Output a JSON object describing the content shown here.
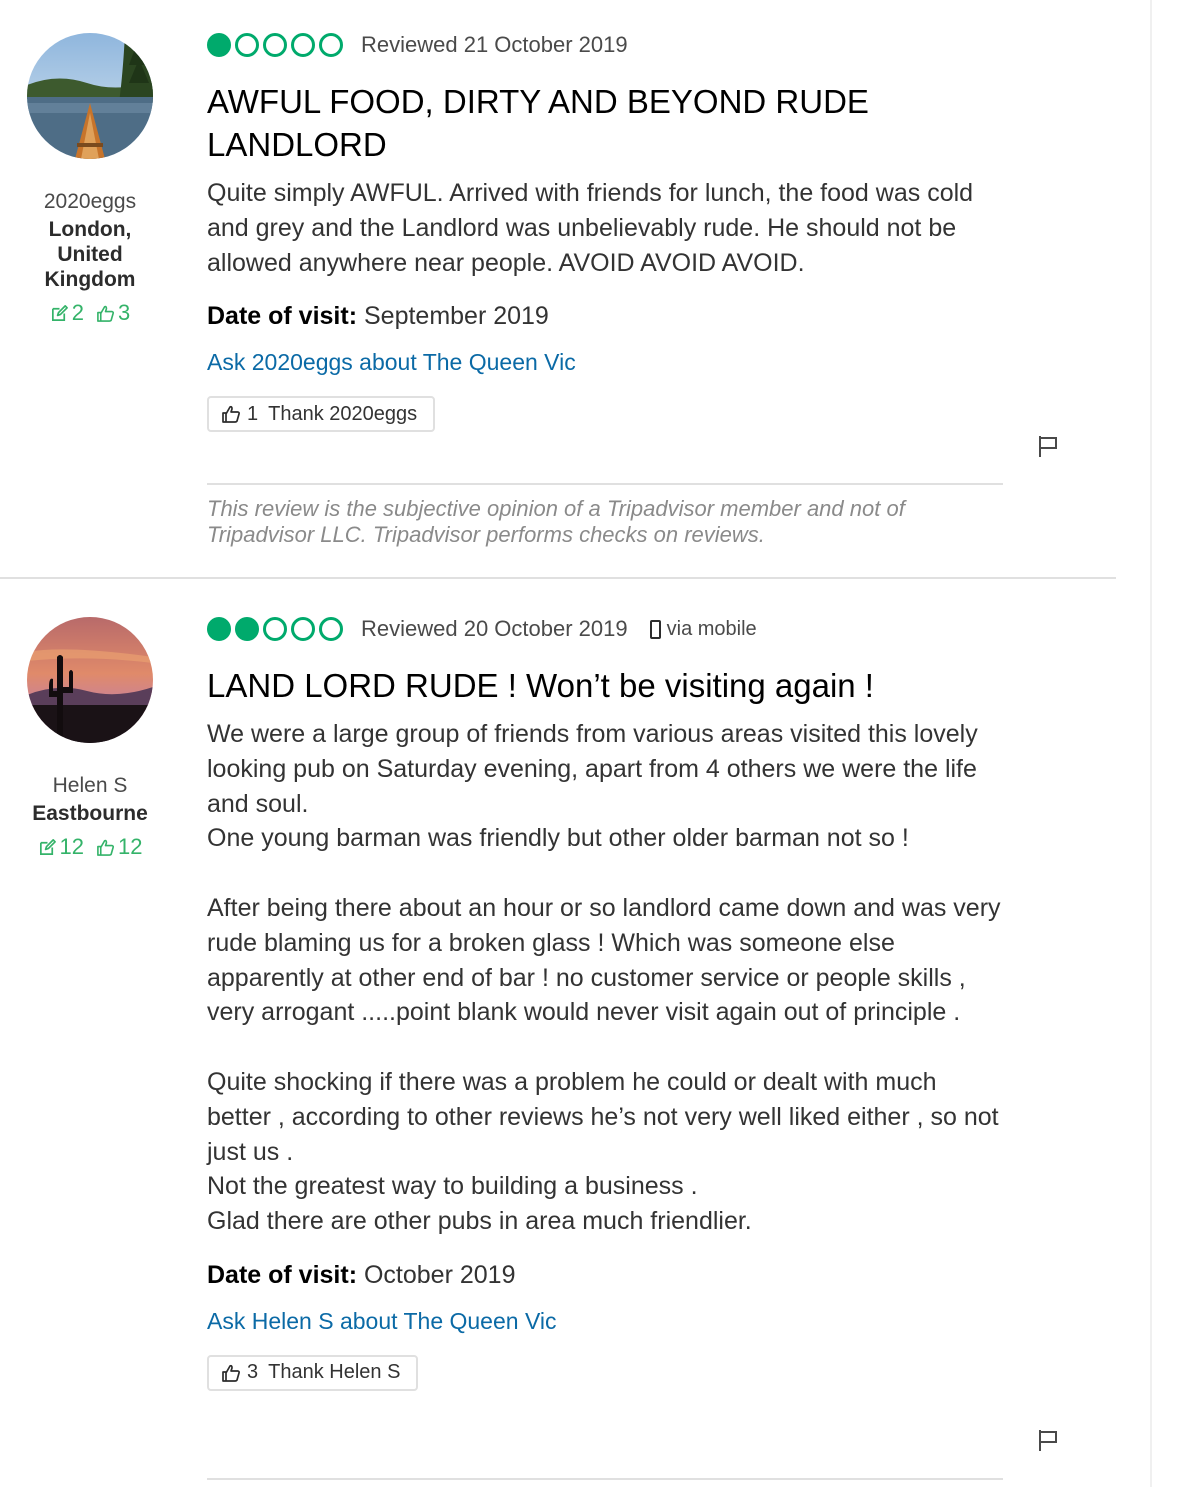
{
  "reviews": [
    {
      "member": {
        "name": "2020eggs",
        "location": "London, United Kingdom",
        "contributions": "2",
        "helpful_votes": "3"
      },
      "rating": 1,
      "reviewed_date": "Reviewed 21 October 2019",
      "via": "",
      "title": "AWFUL FOOD, DIRTY AND BEYOND RUDE LANDLORD",
      "body": "Quite simply AWFUL. Arrived with friends for lunch, the food was cold and grey and the Landlord was unbelievably rude. He should not be allowed anywhere near people. AVOID AVOID AVOID.",
      "date_of_visit_label": "Date of visit:",
      "date_of_visit": "September 2019",
      "ask_link": "Ask 2020eggs about The Queen Vic",
      "thank_count": "1",
      "thank_label": "Thank 2020eggs",
      "disclaimer": "This review is the subjective opinion of a Tripadvisor member and not of Tripadvisor LLC. Tripadvisor performs checks on reviews."
    },
    {
      "member": {
        "name": "Helen S",
        "location": "Eastbourne",
        "contributions": "12",
        "helpful_votes": "12"
      },
      "rating": 2,
      "reviewed_date": "Reviewed 20 October 2019",
      "via": "via mobile",
      "title": "LAND LORD RUDE ! Won’t be visiting again !",
      "body": "We were a large group of friends from various areas visited this lovely looking pub on Saturday evening, apart from 4 others we were the life and soul.\nOne young barman was friendly but other older barman not so !\n\nAfter being there about an hour or so landlord came down and was very rude blaming us for a broken glass ! Which was someone else apparently at other end of bar ! no customer service or people skills , very arrogant .....point blank would never visit again out of principle .\n\nQuite shocking if there was a problem he could or dealt with much better , according to other reviews he’s not very well liked either , so not just us .\nNot the greatest way to building a business .\nGlad there are other pubs in area much friendlier.",
      "date_of_visit_label": "Date of visit:",
      "date_of_visit": "October 2019",
      "ask_link": "Ask Helen S about The Queen Vic",
      "thank_count": "3",
      "thank_label": "Thank Helen S"
    }
  ],
  "colors": {
    "bubble_green": "#00aa6c",
    "stat_green": "#34b369",
    "link_blue": "#0b6aa6"
  },
  "icons": [
    "edit-icon",
    "thumbs-up-icon",
    "flag-icon",
    "mobile-phone-icon",
    "rating-bubble"
  ]
}
